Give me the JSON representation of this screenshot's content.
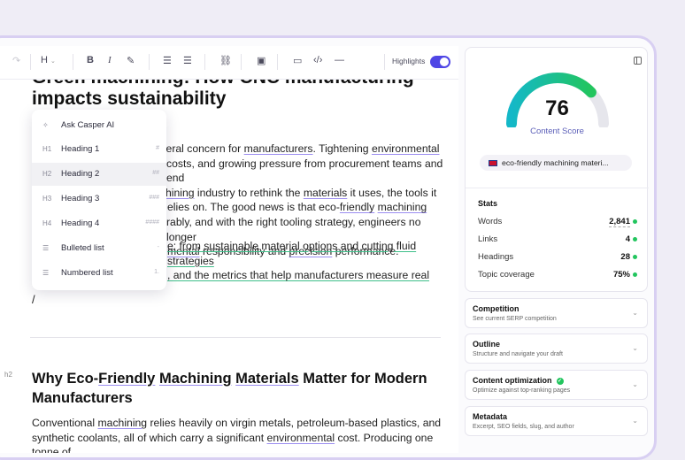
{
  "toolbar": {
    "heading_label": "H",
    "bold": "B",
    "italic": "I",
    "highlights_label": "Highlights"
  },
  "document": {
    "title": "Green machining: How CNC manufacturing impacts sustainability",
    "slash": "/",
    "h2_marker": "h2",
    "h2_title_parts": [
      "Why Eco-",
      "Friendly",
      " ",
      "Machining",
      " ",
      "Materials",
      " Matter for Modern Manufacturers"
    ],
    "p1": {
      "l1": [
        "pheral concern for ",
        "manufacturers",
        ". Tightening ",
        "environmental"
      ],
      "l2": "costs, and growing pressure from procurement teams and end",
      "l3": [
        "hining",
        " industry to rethink the ",
        "materials",
        " it uses, the tools it"
      ],
      "l4": [
        "elies on. The good news is that eco-",
        "friendly",
        " ",
        "machining"
      ],
      "l5": "rably, and with the right tooling strategy, engineers no longer",
      "l6": [
        "mental",
        " responsibility and ",
        "precision",
        " performance."
      ]
    },
    "p2": {
      "l1": [
        "e: from sustainable material options and cutting fluid strategies"
      ],
      "l2": [
        ", and the metrics that help manufacturers measure real"
      ]
    },
    "p3": {
      "l1": [
        "Conventional ",
        "machining",
        " relies heavily on virgin metals, petroleum-based plastics, and"
      ],
      "l2": [
        "synthetic coolants, all of which carry a significant ",
        "environmental",
        " cost. Producing one tonne of"
      ]
    }
  },
  "slash_menu": [
    {
      "icon": "✧",
      "label": "Ask Casper AI",
      "shortcut": ""
    },
    {
      "icon": "H1",
      "label": "Heading 1",
      "shortcut": "#"
    },
    {
      "icon": "H2",
      "label": "Heading 2",
      "shortcut": "##"
    },
    {
      "icon": "H3",
      "label": "Heading 3",
      "shortcut": "###"
    },
    {
      "icon": "H4",
      "label": "Heading 4",
      "shortcut": "####"
    },
    {
      "icon": "☰",
      "label": "Bulleted list",
      "shortcut": "-"
    },
    {
      "icon": "☰",
      "label": "Numbered list",
      "shortcut": "1."
    }
  ],
  "score": {
    "value": "76",
    "label": "Content Score",
    "fraction": 0.76
  },
  "keyword": "eco-friendly machining materi...",
  "stats": {
    "title": "Stats",
    "rows": [
      {
        "label": "Words",
        "value": "2,841"
      },
      {
        "label": "Links",
        "value": "4"
      },
      {
        "label": "Headings",
        "value": "28"
      },
      {
        "label": "Topic coverage",
        "value": "75%"
      }
    ]
  },
  "accordions": [
    {
      "title": "Competition",
      "subtitle": "See current SERP competition"
    },
    {
      "title": "Outline",
      "subtitle": "Structure and navigate your draft"
    },
    {
      "title": "Content optimization",
      "subtitle": "Optimize against top-ranking pages"
    },
    {
      "title": "Metadata",
      "subtitle": "Excerpt, SEO fields, slug, and author"
    }
  ],
  "colors": {
    "accent": "#4f46e5",
    "gauge_start": "#14b8c8",
    "gauge_end": "#22c55e",
    "status_green": "#22c55e"
  }
}
